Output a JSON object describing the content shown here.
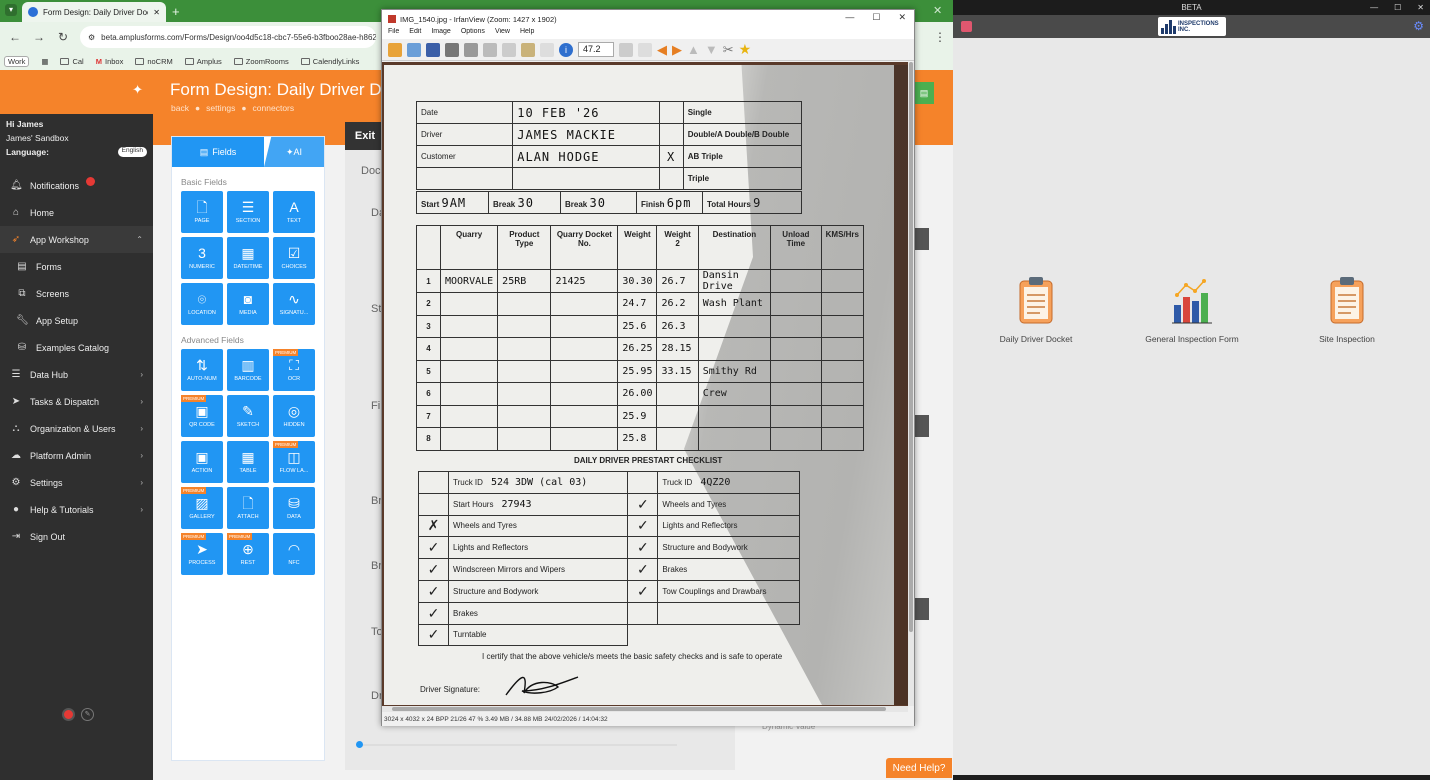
{
  "browser": {
    "tab_title": "Form Design: Daily Driver Docket",
    "url": "beta.amplusforms.com/Forms/Design/oo4d5c18-cbc7-55e6-b3fboo28ae-h862",
    "bookmarks": [
      "Work",
      "Cal",
      "Inbox",
      "noCRM",
      "Amplus",
      "ZoomRooms",
      "CalendlyLinks"
    ]
  },
  "sidebar": {
    "greeting": "Hi James",
    "sandbox": "James' Sandbox",
    "language_label": "Language:",
    "language_value": "English",
    "items": [
      {
        "label": "Notifications",
        "icon": "bell-icon"
      },
      {
        "label": "Home",
        "icon": "home-icon"
      },
      {
        "label": "App Workshop",
        "icon": "rocket-icon"
      },
      {
        "label": "Forms",
        "icon": "clipboard-icon"
      },
      {
        "label": "Screens",
        "icon": "screen-icon"
      },
      {
        "label": "App Setup",
        "icon": "wrench-icon"
      },
      {
        "label": "Examples Catalog",
        "icon": "catalog-icon"
      },
      {
        "label": "Data Hub",
        "icon": "data-icon"
      },
      {
        "label": "Tasks & Dispatch",
        "icon": "send-icon"
      },
      {
        "label": "Organization & Users",
        "icon": "org-icon"
      },
      {
        "label": "Platform Admin",
        "icon": "cloud-icon"
      },
      {
        "label": "Settings",
        "icon": "gear-icon"
      },
      {
        "label": "Help & Tutorials",
        "icon": "help-icon"
      },
      {
        "label": "Sign Out",
        "icon": "signout-icon"
      }
    ]
  },
  "header": {
    "title": "Form Design: Daily Driver D",
    "links": [
      "back",
      "settings",
      "connectors"
    ]
  },
  "fields_panel": {
    "tab_fields": "Fields",
    "tab_ai": "AI",
    "basic_title": "Basic Fields",
    "advanced_title": "Advanced Fields",
    "premium": "PREMIUM",
    "basic": [
      {
        "label": "PAGE",
        "glyph": "🗋"
      },
      {
        "label": "SECTION",
        "glyph": "☰"
      },
      {
        "label": "TEXT",
        "glyph": "A"
      },
      {
        "label": "NUMERIC",
        "glyph": "3"
      },
      {
        "label": "DATE/TIME",
        "glyph": "▦"
      },
      {
        "label": "CHOICES",
        "glyph": "☑"
      },
      {
        "label": "LOCATION",
        "glyph": "⌾"
      },
      {
        "label": "MEDIA",
        "glyph": "◙"
      },
      {
        "label": "SIGNATU...",
        "glyph": "∿"
      }
    ],
    "advanced": [
      {
        "label": "AUTO-NUM",
        "glyph": "⇅",
        "premium": false
      },
      {
        "label": "BARCODE",
        "glyph": "▥",
        "premium": false
      },
      {
        "label": "OCR",
        "glyph": "⛶",
        "premium": true
      },
      {
        "label": "QR CODE",
        "glyph": "▣",
        "premium": true
      },
      {
        "label": "SKETCH",
        "glyph": "✎",
        "premium": false
      },
      {
        "label": "HIDDEN",
        "glyph": "◎",
        "premium": false
      },
      {
        "label": "ACTION",
        "glyph": "▣",
        "premium": false
      },
      {
        "label": "TABLE",
        "glyph": "▦",
        "premium": false
      },
      {
        "label": "FLOW LA...",
        "glyph": "◫",
        "premium": true
      },
      {
        "label": "GALLERY",
        "glyph": "▨",
        "premium": true
      },
      {
        "label": "ATTACH",
        "glyph": "🗋",
        "premium": false
      },
      {
        "label": "DATA",
        "glyph": "⛁",
        "premium": false
      },
      {
        "label": "PROCESS",
        "glyph": "➤",
        "premium": true
      },
      {
        "label": "REST",
        "glyph": "⊕",
        "premium": true
      },
      {
        "label": "NFC",
        "glyph": "◠",
        "premium": false
      }
    ]
  },
  "canvas": {
    "exit": "Exit",
    "frag_doc": "Doc",
    "frag_da": "Da",
    "frag_st": "St",
    "frag_fi": "Fi",
    "frag_br1": "Br",
    "frag_br2": "Br",
    "frag_to": "To",
    "frag_dr": "Dr",
    "dynamic_value": "Dynamic Value",
    "need_help": "Need Help?"
  },
  "irfanview": {
    "title": "IMG_1540.jpg - IrfanView (Zoom: 1427 x 1902)",
    "menu": [
      "File",
      "Edit",
      "Image",
      "Options",
      "View",
      "Help"
    ],
    "zoom": "47.2",
    "status": "3024 x 4032 x 24 BPP   21/26   47 %   3.49 MB / 34.88 MB   24/02/2026 / 14:04:32"
  },
  "docket": {
    "header_rows": [
      {
        "label": "Date",
        "value": "10 FEB '26",
        "mark": "",
        "option": "Single"
      },
      {
        "label": "Driver",
        "value": "JAMES MACKIE",
        "mark": "",
        "option": "Double/A Double/B Double"
      },
      {
        "label": "Customer",
        "value": "ALAN HODGE",
        "mark": "X",
        "option": "AB Triple"
      },
      {
        "label": "",
        "value": "",
        "mark": "",
        "option": "Triple"
      }
    ],
    "times": {
      "start_label": "Start",
      "start": "9AM",
      "break1_label": "Break",
      "break1": "30",
      "break2_label": "Break",
      "break2": "30",
      "finish_label": "Finish",
      "finish": "6pm",
      "total_label": "Total Hours",
      "total": "9"
    },
    "columns": [
      "",
      "Quarry",
      "Product Type",
      "Quarry Docket No.",
      "Weight",
      "Weight 2",
      "Destination",
      "Unload Time",
      "KMS/Hrs"
    ],
    "rows": [
      [
        "1",
        "MOORVALE",
        "25RB",
        "21425",
        "30.30",
        "26.7",
        "Dansin Drive",
        "",
        ""
      ],
      [
        "2",
        "",
        "",
        "",
        "24.7",
        "26.2",
        "Wash Plant",
        "",
        ""
      ],
      [
        "3",
        "",
        "",
        "",
        "25.6",
        "26.3",
        "",
        "",
        ""
      ],
      [
        "4",
        "",
        "",
        "",
        "26.25",
        "28.15",
        "",
        "",
        ""
      ],
      [
        "5",
        "",
        "",
        "",
        "25.95",
        "33.15",
        "Smithy Rd",
        "",
        ""
      ],
      [
        "6",
        "",
        "",
        "",
        "26.00",
        "",
        "Crew",
        "",
        ""
      ],
      [
        "7",
        "",
        "",
        "",
        "25.9",
        "",
        "",
        "",
        ""
      ],
      [
        "8",
        "",
        "",
        "",
        "25.8",
        "",
        "",
        "",
        ""
      ]
    ],
    "checklist_title": "DAILY DRIVER PRESTART CHECKLIST",
    "truck_label": "Truck ID",
    "truck1": "524 3DW (cal 03)",
    "truck2": "4QZ20",
    "start_hours_label": "Start Hours",
    "start_hours": "27943",
    "left_checks": [
      {
        "mark": "✗",
        "item": "Wheels and Tyres"
      },
      {
        "mark": "✓",
        "item": "Lights and Reflectors"
      },
      {
        "mark": "✓",
        "item": "Windscreen Mirrors and Wipers"
      },
      {
        "mark": "✓",
        "item": "Structure and Bodywork"
      },
      {
        "mark": "✓",
        "item": "Brakes"
      },
      {
        "mark": "✓",
        "item": "Turntable"
      }
    ],
    "right_checks": [
      {
        "mark": "✓",
        "item": "Wheels and Tyres"
      },
      {
        "mark": "✓",
        "item": "Lights and Reflectors"
      },
      {
        "mark": "✓",
        "item": "Structure and Bodywork"
      },
      {
        "mark": "✓",
        "item": "Brakes"
      },
      {
        "mark": "✓",
        "item": "Tow Couplings and Drawbars"
      }
    ],
    "certify": "I certify that the above vehicle/s meets the basic safety checks and is safe to operate",
    "signature_label": "Driver Signature:"
  },
  "right_app": {
    "window_title": "BETA",
    "logo_text": "INSPECTIONS INC.",
    "cards": [
      {
        "label": "Daily Driver Docket",
        "icon": "clipboard-icon"
      },
      {
        "label": "General Inspection Form",
        "icon": "bar-chart-icon"
      },
      {
        "label": "Site Inspection",
        "icon": "clipboard-icon"
      }
    ]
  }
}
